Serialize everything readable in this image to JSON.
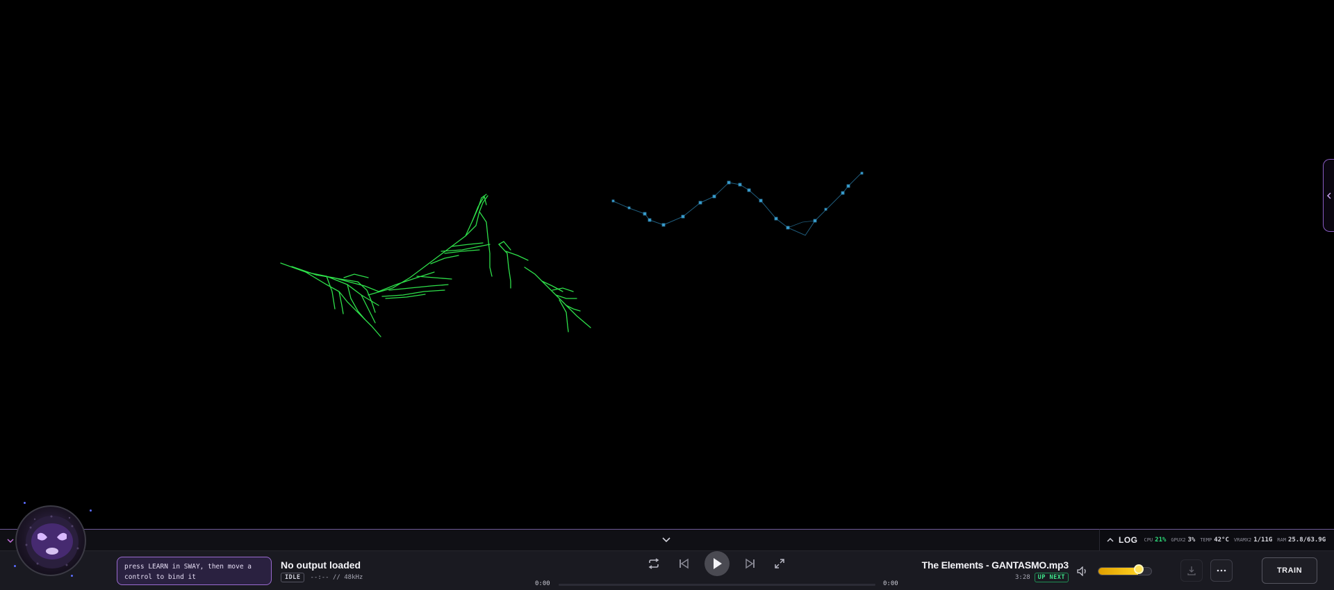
{
  "hint": {
    "line1": "press LEARN in SWAY, then move a",
    "line2": "control to bind it"
  },
  "output": {
    "title": "No output loaded",
    "status_badge": "IDLE",
    "format": "--:-- // 48kHz"
  },
  "transport": {
    "time_elapsed": "0:00",
    "time_total": "0:00",
    "progress": 0
  },
  "up_next": {
    "title": "The Elements - GANTASMO.mp3",
    "duration": "3:28",
    "badge": "UP NEXT"
  },
  "volume": {
    "level": 0.75
  },
  "buttons": {
    "train_label": "TRAIN"
  },
  "stats": {
    "log_label": "LOG",
    "cpu_label": "CPU",
    "cpu_value": "21%",
    "gpu_label": "GPUX2",
    "gpu_value": "3%",
    "temp_label": "TEMP",
    "temp_value": "42°C",
    "vram_label": "VRAMX2",
    "vram_value": "1/11G",
    "ram_label": "RAM",
    "ram_value": "25.8/63.9G"
  },
  "colors": {
    "accent_purple": "#9b6bd1",
    "tree_green": "#2ee04a",
    "points_blue": "#3aa0d0",
    "volume_yellow": "#ffd020",
    "up_next_green": "#3ee88c"
  },
  "icons": {
    "repeat": "repeat-icon",
    "previous": "skip-previous-icon",
    "play": "play-icon",
    "next": "skip-next-icon",
    "fullscreen": "expand-icon",
    "volume": "volume-icon",
    "download": "download-icon",
    "more": "more-icon"
  }
}
